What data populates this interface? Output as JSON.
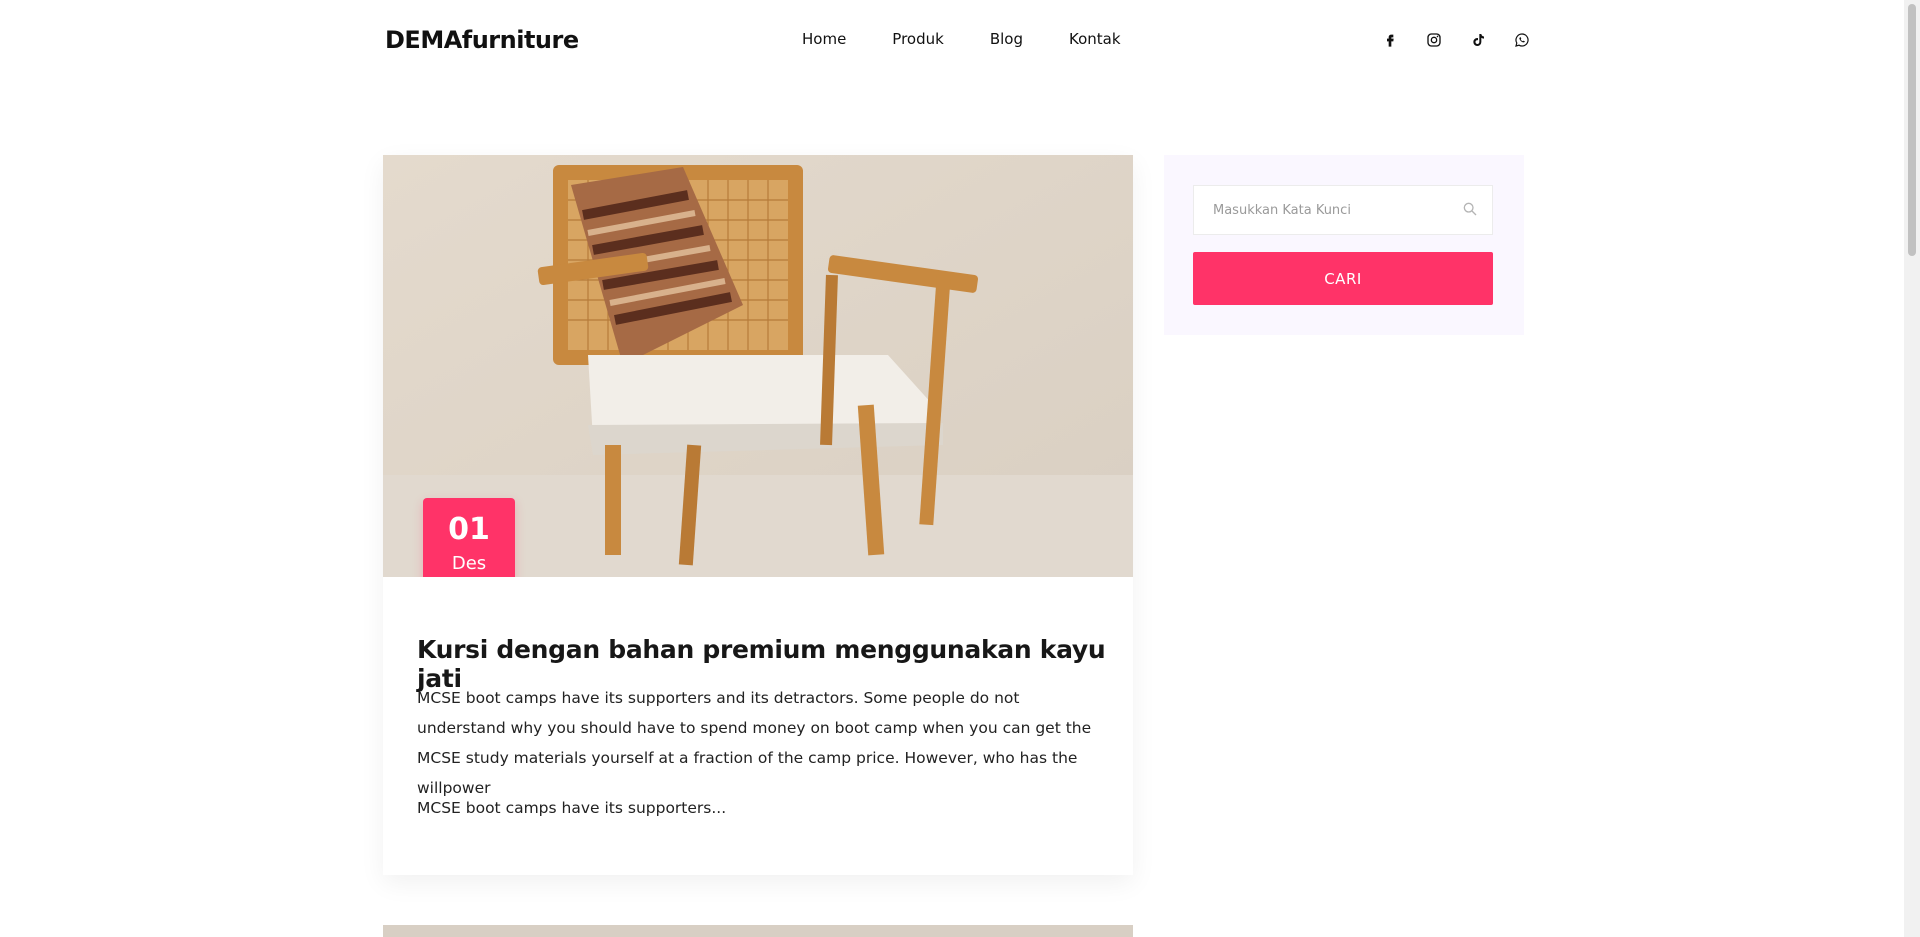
{
  "header": {
    "logo": "DEMAfurniture",
    "nav": [
      "Home",
      "Produk",
      "Blog",
      "Kontak"
    ],
    "social_icons": [
      "facebook-icon",
      "instagram-icon",
      "tiktok-icon",
      "whatsapp-icon"
    ]
  },
  "post": {
    "date_day": "01",
    "date_month": "Des",
    "title": "Kursi dengan bahan premium menggunakan kayu jati",
    "excerpt": "MCSE boot camps have its supporters and its detractors. Some people do not understand why you should have to spend money on boot camp when you can get the MCSE study materials yourself at a fraction of the camp price. However, who has the willpower",
    "more": "MCSE boot camps have its supporters..."
  },
  "sidebar": {
    "search_placeholder": "Masukkan Kata Kunci",
    "search_button": "CARI"
  },
  "colors": {
    "accent": "#ff3368",
    "sidebar_bg": "#faf7ff"
  }
}
